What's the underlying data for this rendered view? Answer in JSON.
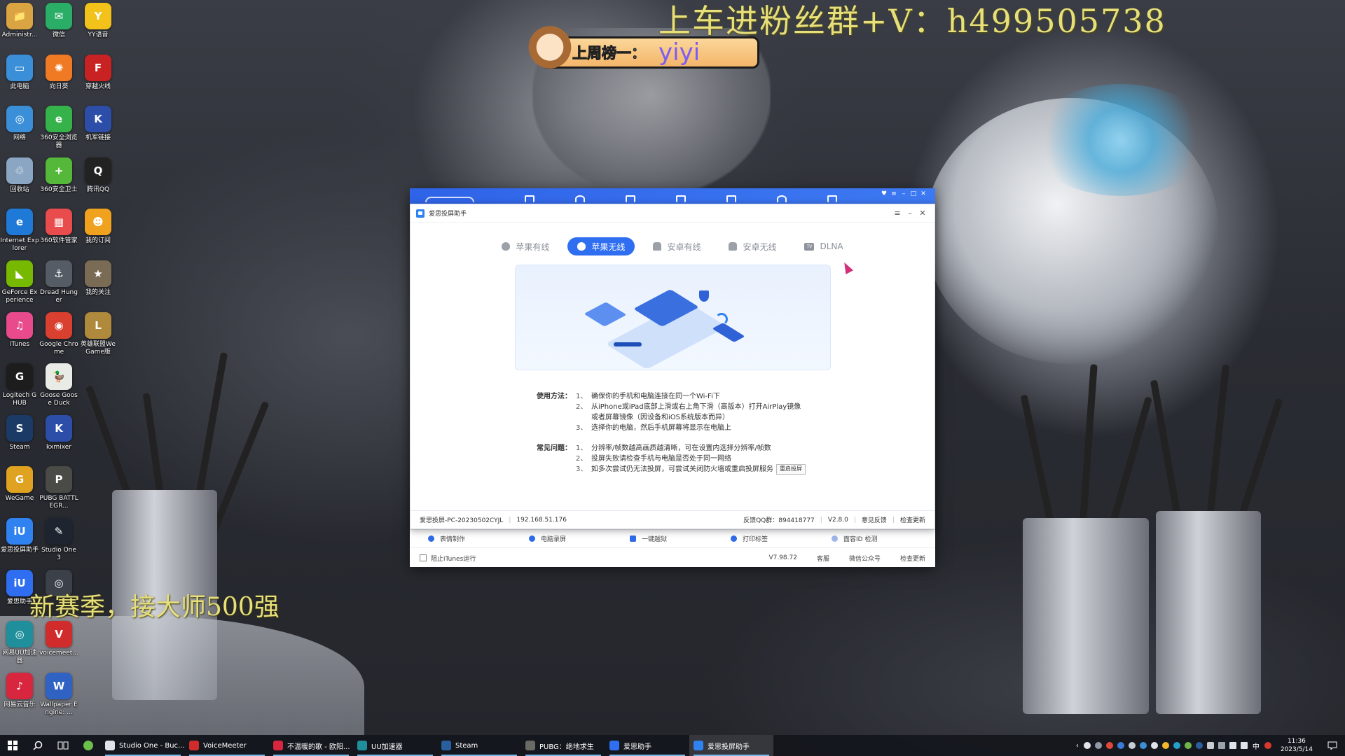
{
  "overlays": {
    "top_banner": "上车进粉丝群+V：h499505738",
    "badge_prefix": "上周榜一：",
    "badge_name": "yiyi",
    "bottom_caption": "新赛季，接大师500强"
  },
  "desktop_icons": [
    {
      "label": "Administr...",
      "color": "#d9a441",
      "glyph": "📁"
    },
    {
      "label": "微信",
      "color": "#2aae67",
      "glyph": "✉"
    },
    {
      "label": "YY语音",
      "color": "#f2c11a",
      "glyph": "Y"
    },
    {
      "label": "此电脑",
      "color": "#3a8fd8",
      "glyph": "▭"
    },
    {
      "label": "向日葵",
      "color": "#f07a24",
      "glyph": "✺"
    },
    {
      "label": "穿越火线",
      "color": "#c92222",
      "glyph": "F"
    },
    {
      "label": "网络",
      "color": "#3a8fd8",
      "glyph": "◎"
    },
    {
      "label": "360安全浏览器",
      "color": "#36b24a",
      "glyph": "e"
    },
    {
      "label": "机军链接",
      "color": "#2c4ea8",
      "glyph": "K"
    },
    {
      "label": "回收站",
      "color": "#8aa6c2",
      "glyph": "♲"
    },
    {
      "label": "360安全卫士",
      "color": "#56b83a",
      "glyph": "+"
    },
    {
      "label": "腾讯QQ",
      "color": "#222222",
      "glyph": "Q"
    },
    {
      "label": "Internet Explorer",
      "color": "#1e7ad6",
      "glyph": "e"
    },
    {
      "label": "360软件管家",
      "color": "#e84c4c",
      "glyph": "▦"
    },
    {
      "label": "我的订阅",
      "color": "#f0a21e",
      "glyph": "☻"
    },
    {
      "label": "GeForce Experience",
      "color": "#76b900",
      "glyph": "◣"
    },
    {
      "label": "Dread Hunger",
      "color": "#555c66",
      "glyph": "⚓"
    },
    {
      "label": "我的关注",
      "color": "#7a6b55",
      "glyph": "★"
    },
    {
      "label": "iTunes",
      "color": "#e84a8c",
      "glyph": "♫"
    },
    {
      "label": "Google Chrome",
      "color": "#d9402f",
      "glyph": "◉"
    },
    {
      "label": "英雄联盟WeGame版",
      "color": "#b08a3c",
      "glyph": "L"
    },
    {
      "label": "Logitech G HUB",
      "color": "#1d1d1d",
      "glyph": "G"
    },
    {
      "label": "Goose Goose Duck",
      "color": "#e9ece6",
      "glyph": "🦆"
    },
    {
      "label": "",
      "color": "rgba(0,0,0,0)",
      "glyph": ""
    },
    {
      "label": "Steam",
      "color": "#1b3b66",
      "glyph": "S"
    },
    {
      "label": "kxmixer",
      "color": "#2c4ea8",
      "glyph": "K"
    },
    {
      "label": "",
      "color": "rgba(0,0,0,0)",
      "glyph": ""
    },
    {
      "label": "WeGame",
      "color": "#e0a321",
      "glyph": "G"
    },
    {
      "label": "PUBG BATTLEGR...",
      "color": "#4a4a46",
      "glyph": "P"
    },
    {
      "label": "",
      "color": "rgba(0,0,0,0)",
      "glyph": ""
    },
    {
      "label": "爱思投屏助手",
      "color": "#2f82f0",
      "glyph": "iU"
    },
    {
      "label": "Studio One 3",
      "color": "#1e2530",
      "glyph": "✎"
    },
    {
      "label": "",
      "color": "rgba(0,0,0,0)",
      "glyph": ""
    },
    {
      "label": "爱思助手",
      "color": "#2f6ef0",
      "glyph": "iU"
    },
    {
      "label": "",
      "color": "#3c4048",
      "glyph": "◎"
    },
    {
      "label": "",
      "color": "rgba(0,0,0,0)",
      "glyph": ""
    },
    {
      "label": "网易UU加速器",
      "color": "#1f8f9c",
      "glyph": "◎"
    },
    {
      "label": "voicemeet...",
      "color": "#d12c2c",
      "glyph": "V"
    },
    {
      "label": "",
      "color": "rgba(0,0,0,0)",
      "glyph": ""
    },
    {
      "label": "网易云音乐",
      "color": "#d7263d",
      "glyph": "♪"
    },
    {
      "label": "Wallpaper Engine: ...",
      "color": "#2f62c2",
      "glyph": "W"
    },
    {
      "label": "",
      "color": "rgba(0,0,0,0)",
      "glyph": ""
    }
  ],
  "back_window": {
    "tools": [
      "表情制作",
      "电脑录屏",
      "一键越狱",
      "打印标签",
      "面容ID 检测"
    ],
    "checkbox_label": "阻止iTunes运行",
    "version": "V7.98.72",
    "links": [
      "客服",
      "微信公众号",
      "检查更新"
    ]
  },
  "front_window": {
    "title": "爱思投屏助手",
    "tabs": [
      "苹果有线",
      "苹果无线",
      "安卓有线",
      "安卓无线",
      "DLNA"
    ],
    "active_tab": "苹果无线",
    "usage_heading": "使用方法：",
    "usage": [
      {
        "n": "1、",
        "text": "确保你的手机和电脑连接在同一个Wi-Fi下"
      },
      {
        "n": "2、",
        "text": "从iPhone或iPad底部上滑或右上角下滑（高版本）打开AirPlay镜像"
      },
      {
        "n": "",
        "text": "或者屏幕镜像（因设备和iOS系统版本而异）"
      },
      {
        "n": "3、",
        "text": "选择你的电脑，然后手机屏幕将显示在电脑上"
      }
    ],
    "faq_heading": "常见问题：",
    "faq": [
      {
        "n": "1、",
        "text": "分辨率/帧数越高画质越清晰，可在设置内选择分辨率/帧数"
      },
      {
        "n": "2、",
        "text": "投屏失败请检查手机与电脑是否处于同一网络"
      },
      {
        "n": "3、",
        "text": "如多次尝试仍无法投屏，可尝试关闭防火墙或重启投屏服务"
      }
    ],
    "restart_btn": "重启投屏",
    "status": {
      "device_name": "爱思投屏-PC-20230502CYJL",
      "ip": "192.168.51.176",
      "qq_group": "反馈QQ群：894418777",
      "version": "V2.8.0",
      "feedback": "意见反馈",
      "update": "检查更新"
    }
  },
  "taskbar": {
    "apps": [
      {
        "label": "Studio One - Buc...",
        "color": "#dfe3ea",
        "active": false
      },
      {
        "label": "VoiceMeeter",
        "color": "#d12c2c",
        "active": false
      },
      {
        "label": "不温暖的歌 - 欧阳...",
        "color": "#d7263d",
        "active": false
      },
      {
        "label": "UU加速器",
        "color": "#1f8f9c",
        "active": false
      },
      {
        "label": "Steam",
        "color": "#2a5f9e",
        "active": false
      },
      {
        "label": "PUBG：绝地求生",
        "color": "#6a6a64",
        "active": false
      },
      {
        "label": "爱思助手",
        "color": "#2f6ef0",
        "active": false
      },
      {
        "label": "爱思投屏助手",
        "color": "#2f82f0",
        "active": true
      }
    ],
    "ime": "中",
    "time": "11:36",
    "date": "2023/5/14"
  }
}
